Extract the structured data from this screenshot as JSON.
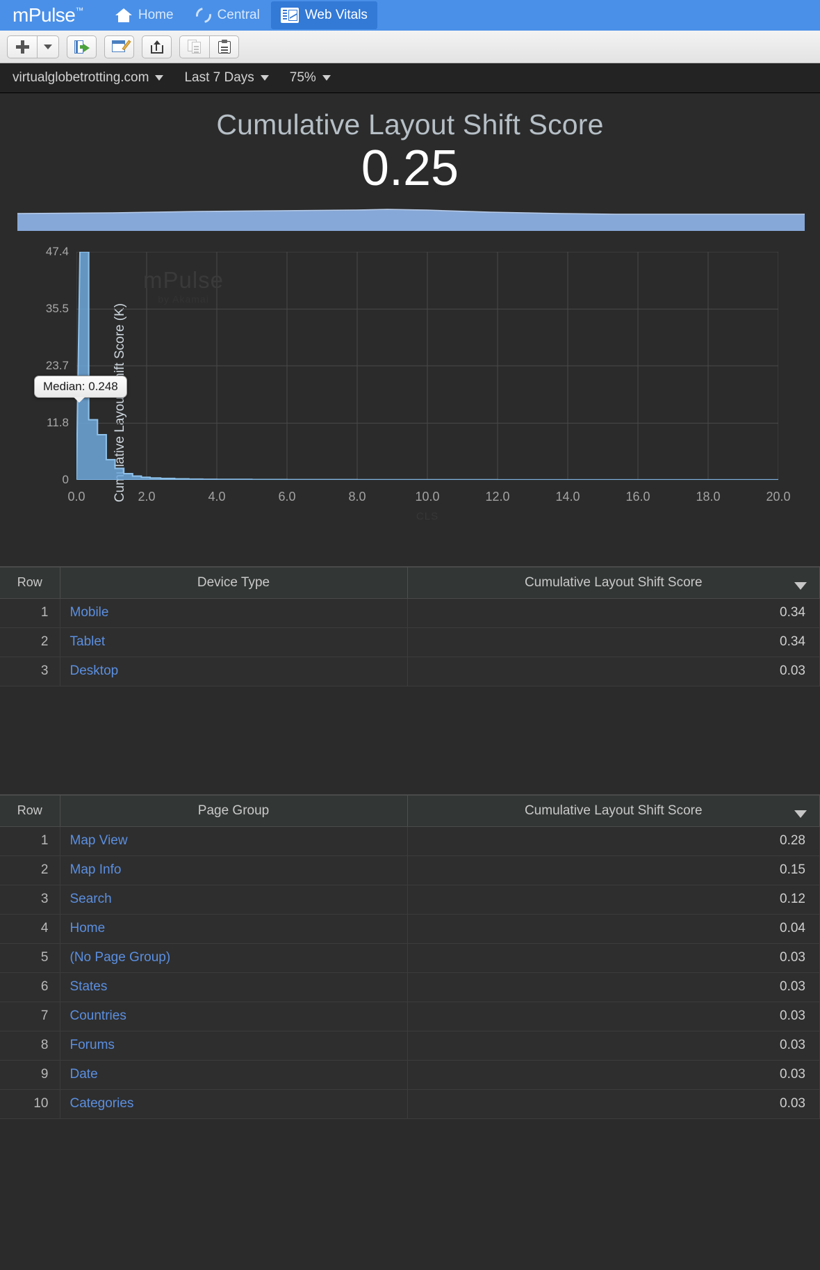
{
  "topnav": {
    "brand": "mPulse",
    "brand_tm": "™",
    "items": [
      {
        "label": "Home",
        "icon": "home-icon",
        "active": false
      },
      {
        "label": "Central",
        "icon": "ring-icon",
        "active": false
      },
      {
        "label": "Web Vitals",
        "icon": "chart-icon",
        "active": true
      }
    ],
    "bg_color": "#4a90e8",
    "active_bg_color": "#3379d6"
  },
  "toolbar": {
    "buttons": [
      {
        "name": "add-button",
        "icon": "plus-icon",
        "label": ""
      },
      {
        "name": "add-dropdown-button",
        "icon": "caret-down-icon",
        "label": ""
      },
      {
        "name": "open-button",
        "icon": "open-page-icon",
        "label": ""
      },
      {
        "name": "edit-button",
        "icon": "edit-pencil-icon",
        "label": ""
      },
      {
        "name": "share-button",
        "icon": "share-export-icon",
        "label": ""
      },
      {
        "name": "copy-button",
        "icon": "copy-icon",
        "label": ""
      },
      {
        "name": "paste-button",
        "icon": "paste-clipboard-icon",
        "label": ""
      }
    ]
  },
  "filterbar": {
    "domain": "virtualglobetrotting.com",
    "date_range": "Last 7 Days",
    "percentile": "75%"
  },
  "headline": {
    "title": "Cumulative Layout Shift Score",
    "value": "0.25"
  },
  "chart_data": {
    "type": "bar",
    "title": "Cumulative Layout Shift Score",
    "xlabel": "CLS",
    "ylabel": "Cumulative Layout Shift Score (K)",
    "yticks": [
      "47.4",
      "35.5",
      "23.7",
      "11.8",
      "0"
    ],
    "ytick_values": [
      47.4,
      35.5,
      23.7,
      11.8,
      0
    ],
    "xticks": [
      "0.0",
      "2.0",
      "4.0",
      "6.0",
      "8.0",
      "10.0",
      "12.0",
      "14.0",
      "16.0",
      "18.0",
      "20.0"
    ],
    "xtick_values": [
      0,
      2,
      4,
      6,
      8,
      10,
      12,
      14,
      16,
      18,
      20
    ],
    "xlim": [
      0,
      20
    ],
    "ylim": [
      0,
      47.4
    ],
    "grid": true,
    "legend": "none",
    "series_color": "#6fa8dc",
    "x": [
      0.1,
      0.35,
      0.6,
      0.85,
      1.1,
      1.35,
      1.6,
      1.85,
      2.1,
      2.4,
      2.8,
      3.2,
      3.6,
      4.0,
      5.0,
      6.0,
      8.0,
      10.0,
      12.0,
      14.0,
      16.0,
      18.0,
      20.0
    ],
    "values": [
      47.4,
      12.5,
      9.4,
      4.2,
      2.4,
      1.3,
      0.8,
      0.55,
      0.4,
      0.3,
      0.22,
      0.17,
      0.13,
      0.1,
      0.07,
      0.05,
      0.04,
      0.03,
      0.02,
      0.02,
      0.01,
      0.01,
      0.0
    ],
    "annotation": {
      "label": "Median: 0.248",
      "value": 0.248
    },
    "watermark_line1": "mPulse",
    "watermark_line2": "by Akamai",
    "sparkband_color": "#86a8d8"
  },
  "device_table": {
    "name": "device-type-table",
    "columns": [
      "Row",
      "Device Type",
      "Cumulative Layout Shift Score"
    ],
    "sort_column": 2,
    "sort_direction": "desc",
    "rows": [
      {
        "row": "1",
        "label": "Mobile",
        "score": "0.34"
      },
      {
        "row": "2",
        "label": "Tablet",
        "score": "0.34"
      },
      {
        "row": "3",
        "label": "Desktop",
        "score": "0.03"
      }
    ]
  },
  "pagegroup_table": {
    "name": "page-group-table",
    "columns": [
      "Row",
      "Page Group",
      "Cumulative Layout Shift Score"
    ],
    "sort_column": 2,
    "sort_direction": "desc",
    "rows": [
      {
        "row": "1",
        "label": "Map View",
        "score": "0.28"
      },
      {
        "row": "2",
        "label": "Map Info",
        "score": "0.15"
      },
      {
        "row": "3",
        "label": "Search",
        "score": "0.12"
      },
      {
        "row": "4",
        "label": "Home",
        "score": "0.04"
      },
      {
        "row": "5",
        "label": "(No Page Group)",
        "score": "0.03"
      },
      {
        "row": "6",
        "label": "States",
        "score": "0.03"
      },
      {
        "row": "7",
        "label": "Countries",
        "score": "0.03"
      },
      {
        "row": "8",
        "label": "Forums",
        "score": "0.03"
      },
      {
        "row": "9",
        "label": "Date",
        "score": "0.03"
      },
      {
        "row": "10",
        "label": "Categories",
        "score": "0.03"
      }
    ]
  },
  "colors": {
    "accent_blue": "#4a90e8",
    "link_blue": "#5b8fe0",
    "page_bg": "#2b2b2b",
    "header_bg": "#323635"
  }
}
